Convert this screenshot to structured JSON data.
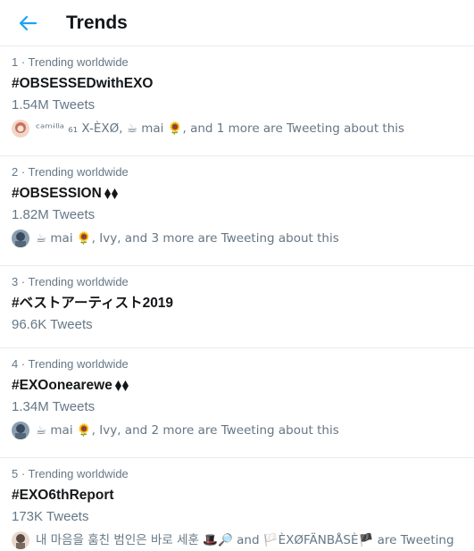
{
  "header": {
    "title": "Trends"
  },
  "trends": [
    {
      "meta": "1 · Trending worldwide",
      "name": "#OBSESSEDwithEXO",
      "count": "1.54M Tweets",
      "context": "ᶜᵃᵐᶤˡˡᵃ ₆₁ X-ÈXØ, ☕ mai 🌻, and 1 more are Tweeting about this",
      "avatar_colors": [
        "#c9705a",
        "#f1d6c9"
      ]
    },
    {
      "meta": "2 · Trending worldwide",
      "name": "#OBSESSION",
      "count": "1.82M Tweets",
      "context": "☕ mai 🌻, Ivy, and 3 more are Tweeting about this",
      "avatar_colors": [
        "#3a4a5c",
        "#8a9db0"
      ]
    },
    {
      "meta": "3 · Trending worldwide",
      "name": "#ベストアーティスト2019",
      "count": "96.6K Tweets"
    },
    {
      "meta": "4 · Trending worldwide",
      "name": "#EXOonearewe",
      "count": "1.34M Tweets",
      "context": "☕ mai 🌻, Ivy, and 2 more are Tweeting about this",
      "avatar_colors": [
        "#3a4a5c",
        "#8a9db0"
      ]
    },
    {
      "meta": "5 · Trending worldwide",
      "name": "#EXO6thReport",
      "count": "173K Tweets",
      "context": "내 마음을 훔친 범인은 바로 세훈 🎩🔎 and 🏳️ÈXØFÄNBÅSÈ🏴 are Tweeting",
      "avatar_colors": [
        "#5a4a42",
        "#e8d8cc"
      ]
    }
  ],
  "colors": {
    "accent": "#1da1f2",
    "muted": "#657786",
    "text": "#14171a",
    "divider": "#e6ecf0"
  }
}
